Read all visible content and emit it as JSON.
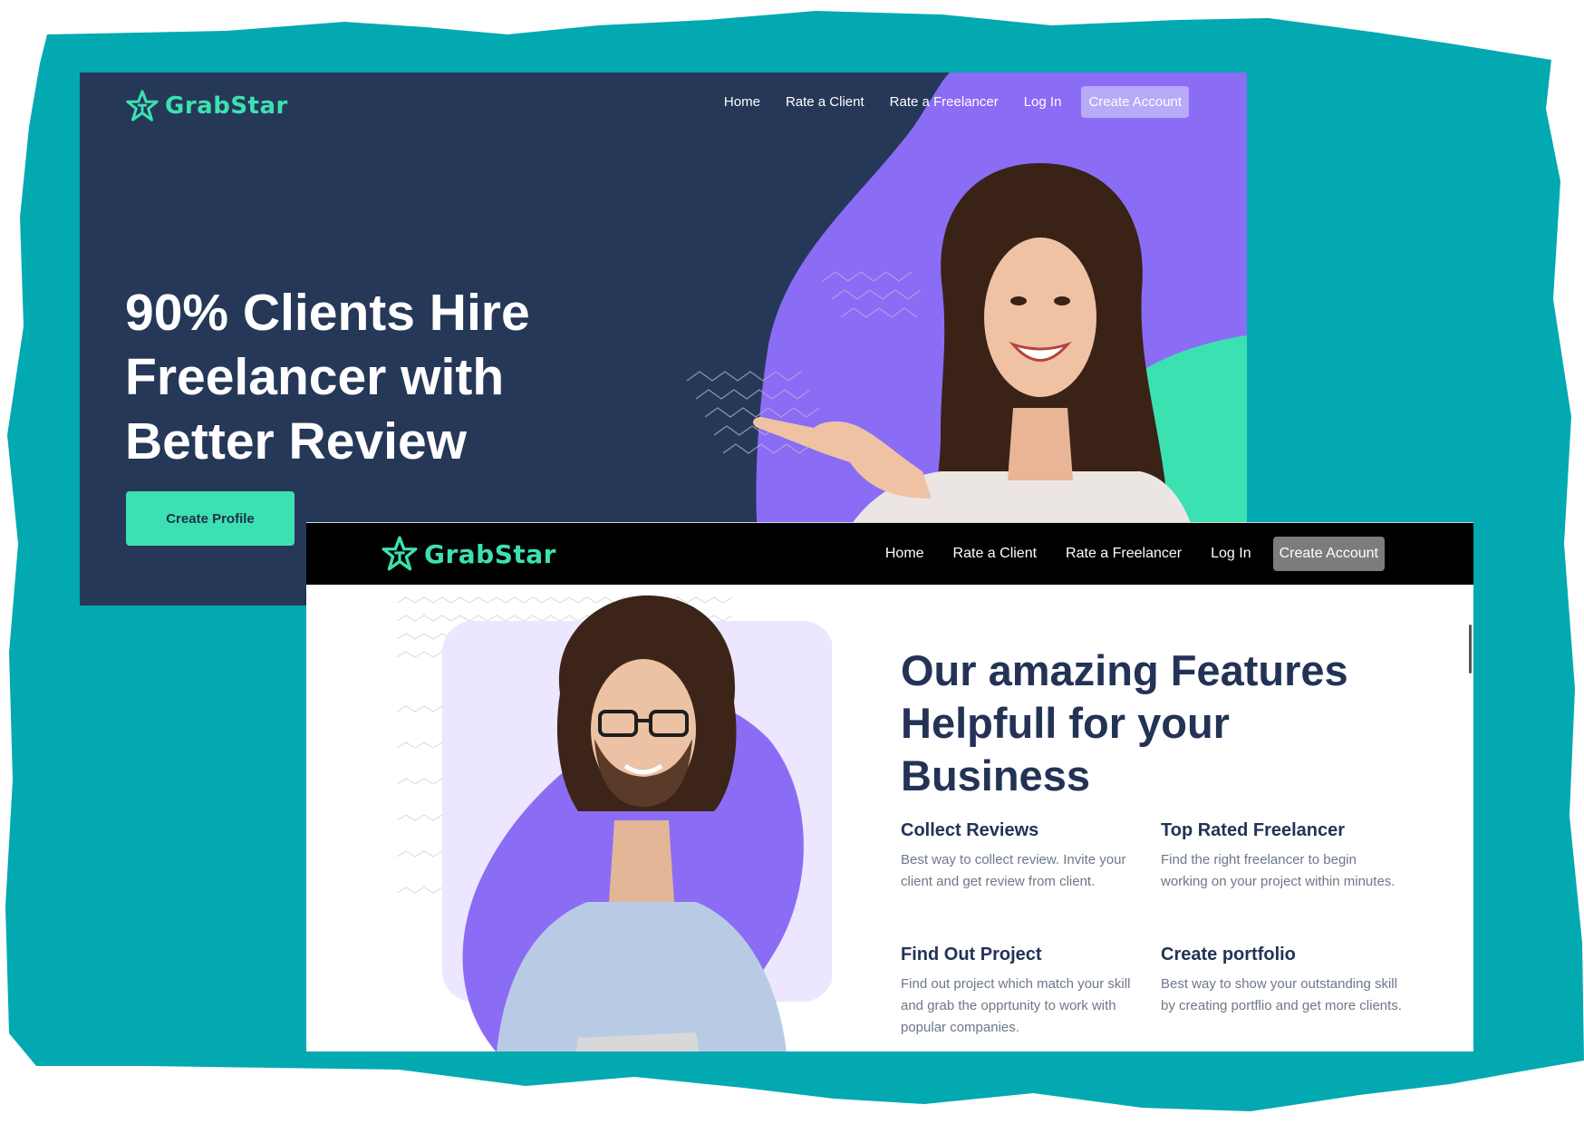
{
  "colors": {
    "teal_backdrop": "#02a9b1",
    "hero_bg": "#263858",
    "accent_green": "#3ce1b1",
    "accent_purple": "#8b6cf5",
    "light_purple": "#ece6ff",
    "feature_title": "#233356"
  },
  "hero_page": {
    "logo": {
      "icon": "star-icon",
      "text": "GrabStar"
    },
    "nav": {
      "items": [
        {
          "label": "Home"
        },
        {
          "label": "Rate a Client"
        },
        {
          "label": "Rate a Freelancer"
        },
        {
          "label": "Log In"
        }
      ],
      "cta_label": "Create Account"
    },
    "headline": "90% Clients Hire Freelancer with Better Review",
    "cta_button": "Create Profile"
  },
  "features_page": {
    "logo": {
      "icon": "star-icon",
      "text": "GrabStar"
    },
    "nav": {
      "items": [
        {
          "label": "Home"
        },
        {
          "label": "Rate a Client"
        },
        {
          "label": "Rate a Freelancer"
        },
        {
          "label": "Log In"
        }
      ],
      "cta_label": "Create Account"
    },
    "title": "Our amazing Features Helpfull for your Business",
    "features": [
      {
        "heading": "Collect Reviews",
        "description": "Best way to collect review. Invite your client and get review from client."
      },
      {
        "heading": "Top Rated Freelancer",
        "description": "Find the right freelancer to begin working on your project within minutes."
      },
      {
        "heading": "Find Out Project",
        "description": "Find out project which match your skill and grab the opprtunity to work with popular companies."
      },
      {
        "heading": "Create portfolio",
        "description": "Best way to show your outstanding skill by creating portflio and get more clients."
      }
    ]
  }
}
